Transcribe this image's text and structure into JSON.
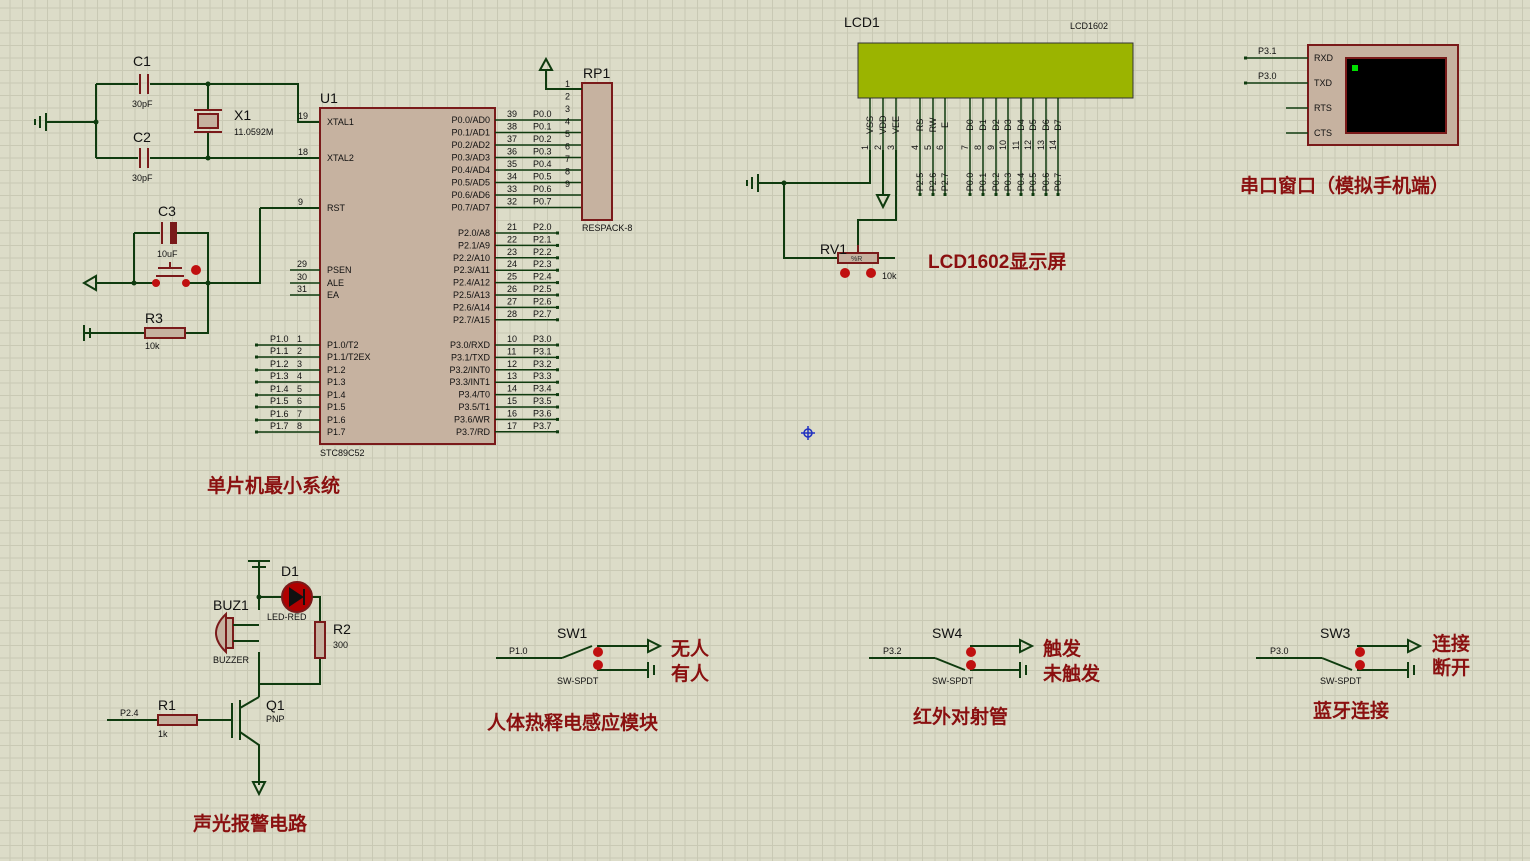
{
  "mcu": {
    "ref": "U1",
    "part": "STC89C52",
    "left_pins": [
      {
        "num": "19",
        "name": "XTAL1"
      },
      {
        "num": "18",
        "name": "XTAL2"
      },
      {
        "num": "9",
        "name": "RST"
      },
      {
        "num": "29",
        "name": "PSEN"
      },
      {
        "num": "30",
        "name": "ALE"
      },
      {
        "num": "31",
        "name": "EA"
      },
      {
        "num": "1",
        "name": "P1.0/T2",
        "net": "P1.0"
      },
      {
        "num": "2",
        "name": "P1.1/T2EX",
        "net": "P1.1"
      },
      {
        "num": "3",
        "name": "P1.2",
        "net": "P1.2"
      },
      {
        "num": "4",
        "name": "P1.3",
        "net": "P1.3"
      },
      {
        "num": "5",
        "name": "P1.4",
        "net": "P1.4"
      },
      {
        "num": "6",
        "name": "P1.5",
        "net": "P1.5"
      },
      {
        "num": "7",
        "name": "P1.6",
        "net": "P1.6"
      },
      {
        "num": "8",
        "name": "P1.7",
        "net": "P1.7"
      }
    ],
    "right_pins": [
      {
        "num": "39",
        "name": "P0.0/AD0",
        "net": "P0.0"
      },
      {
        "num": "38",
        "name": "P0.1/AD1",
        "net": "P0.1"
      },
      {
        "num": "37",
        "name": "P0.2/AD2",
        "net": "P0.2"
      },
      {
        "num": "36",
        "name": "P0.3/AD3",
        "net": "P0.3"
      },
      {
        "num": "35",
        "name": "P0.4/AD4",
        "net": "P0.4"
      },
      {
        "num": "34",
        "name": "P0.5/AD5",
        "net": "P0.5"
      },
      {
        "num": "33",
        "name": "P0.6/AD6",
        "net": "P0.6"
      },
      {
        "num": "32",
        "name": "P0.7/AD7",
        "net": "P0.7"
      },
      {
        "num": "21",
        "name": "P2.0/A8",
        "net": "P2.0"
      },
      {
        "num": "22",
        "name": "P2.1/A9",
        "net": "P2.1"
      },
      {
        "num": "23",
        "name": "P2.2/A10",
        "net": "P2.2"
      },
      {
        "num": "24",
        "name": "P2.3/A11",
        "net": "P2.3"
      },
      {
        "num": "25",
        "name": "P2.4/A12",
        "net": "P2.4"
      },
      {
        "num": "26",
        "name": "P2.5/A13",
        "net": "P2.5"
      },
      {
        "num": "27",
        "name": "P2.6/A14",
        "net": "P2.6"
      },
      {
        "num": "28",
        "name": "P2.7/A15",
        "net": "P2.7"
      },
      {
        "num": "10",
        "name": "P3.0/RXD",
        "net": "P3.0"
      },
      {
        "num": "11",
        "name": "P3.1/TXD",
        "net": "P3.1"
      },
      {
        "num": "12",
        "name": "P3.2/INT0",
        "net": "P3.2"
      },
      {
        "num": "13",
        "name": "P3.3/INT1",
        "net": "P3.3"
      },
      {
        "num": "14",
        "name": "P3.4/T0",
        "net": "P3.4"
      },
      {
        "num": "15",
        "name": "P3.5/T1",
        "net": "P3.5"
      },
      {
        "num": "16",
        "name": "P3.6/WR",
        "net": "P3.6"
      },
      {
        "num": "17",
        "name": "P3.7/RD",
        "net": "P3.7"
      }
    ]
  },
  "rp1": {
    "ref": "RP1",
    "part": "RESPACK-8",
    "pins": [
      "1",
      "2",
      "3",
      "4",
      "5",
      "6",
      "7",
      "8",
      "9"
    ]
  },
  "c1": {
    "ref": "C1",
    "value": "30pF"
  },
  "c2": {
    "ref": "C2",
    "value": "30pF"
  },
  "x1": {
    "ref": "X1",
    "value": "11.0592M"
  },
  "c3": {
    "ref": "C3",
    "value": "10uF"
  },
  "r3": {
    "ref": "R3",
    "value": "10k"
  },
  "lcd": {
    "ref": "LCD1",
    "part": "LCD1602",
    "screen_color": "#9bb400",
    "pins": [
      {
        "name": "VSS",
        "num": "1"
      },
      {
        "name": "VDD",
        "num": "2"
      },
      {
        "name": "VEE",
        "num": "3"
      },
      {
        "name": "RS",
        "num": "4",
        "net": "P2.5"
      },
      {
        "name": "RW",
        "num": "5",
        "net": "P2.6"
      },
      {
        "name": "E",
        "num": "6",
        "net": "P2.7"
      },
      {
        "name": "D0",
        "num": "7",
        "net": "P0.0"
      },
      {
        "name": "D1",
        "num": "8",
        "net": "P0.1"
      },
      {
        "name": "D2",
        "num": "9",
        "net": "P0.2"
      },
      {
        "name": "D3",
        "num": "10",
        "net": "P0.3"
      },
      {
        "name": "D4",
        "num": "11",
        "net": "P0.4"
      },
      {
        "name": "D5",
        "num": "12",
        "net": "P0.5"
      },
      {
        "name": "D6",
        "num": "13",
        "net": "P0.6"
      },
      {
        "name": "D7",
        "num": "14",
        "net": "P0.7"
      }
    ]
  },
  "rv1": {
    "ref": "RV1",
    "value": "10k",
    "setting": "%R"
  },
  "terminal": {
    "pins": [
      "RXD",
      "TXD",
      "RTS",
      "CTS"
    ],
    "nets": [
      "P3.1",
      "P3.0"
    ],
    "screen_color": "#000000",
    "cursor_color": "#00e000"
  },
  "buzzer": {
    "ref": "BUZ1",
    "part": "BUZZER"
  },
  "d1": {
    "ref": "D1",
    "part": "LED-RED"
  },
  "r2": {
    "ref": "R2",
    "value": "300"
  },
  "r1": {
    "ref": "R1",
    "value": "1k",
    "net": "P2.4"
  },
  "q1": {
    "ref": "Q1",
    "part": "PNP"
  },
  "sw1": {
    "ref": "SW1",
    "part": "SW-SPDT",
    "net": "P1.0",
    "label_top": "无人",
    "label_bottom": "有人"
  },
  "sw4": {
    "ref": "SW4",
    "part": "SW-SPDT",
    "net": "P3.2",
    "label_top": "触发",
    "label_bottom": "未触发"
  },
  "sw3": {
    "ref": "SW3",
    "part": "SW-SPDT",
    "net": "P3.0",
    "label_top": "连接",
    "label_bottom": "断开"
  },
  "captions": {
    "mcu": "单片机最小系统",
    "lcd": "LCD1602显示屏",
    "terminal": "串口窗口（模拟手机端）",
    "alarm": "声光报警电路",
    "pir": "人体热释电感应模块",
    "ir": "红外对射管",
    "bt": "蓝牙连接"
  }
}
